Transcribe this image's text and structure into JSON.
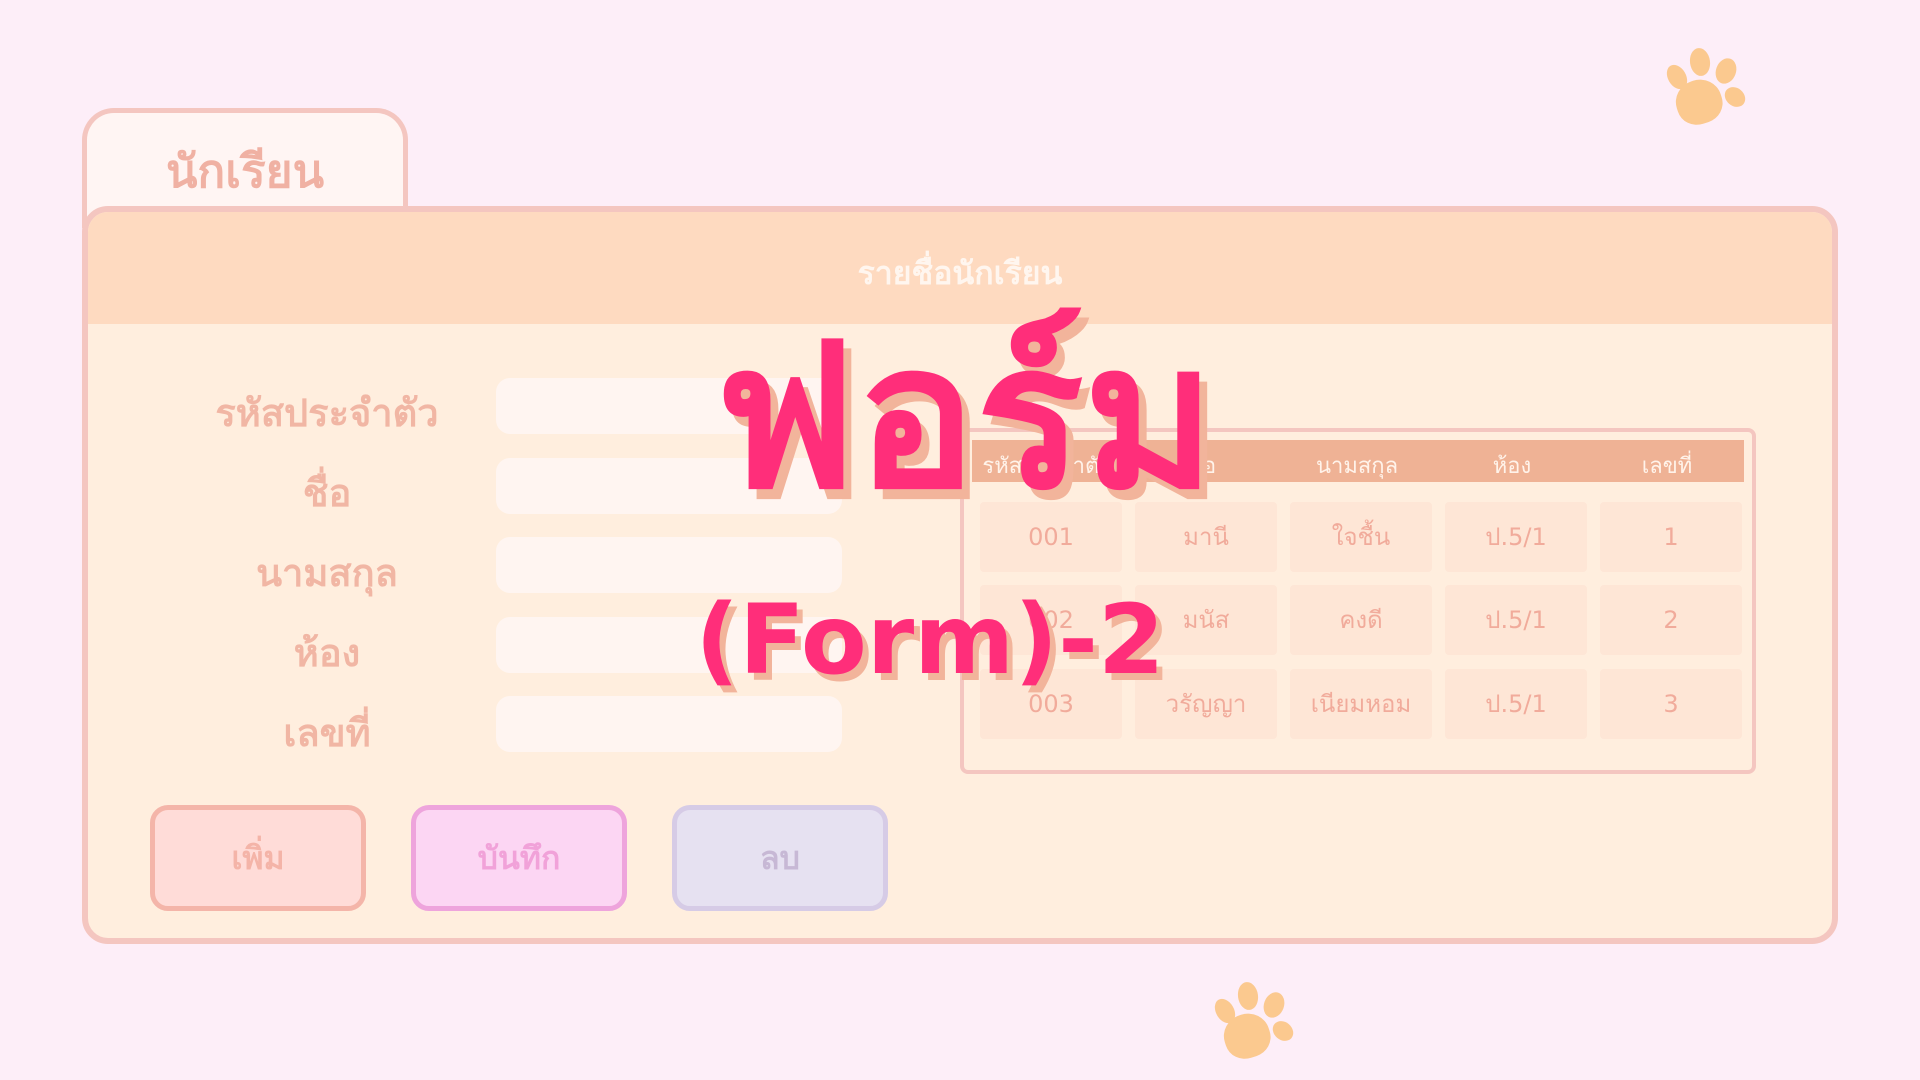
{
  "tab": {
    "label": "นักเรียน"
  },
  "window": {
    "title": "รายชื่อนักเรียน"
  },
  "form": {
    "fields": [
      {
        "label": "รหัสประจำตัว",
        "value": ""
      },
      {
        "label": "ชื่อ",
        "value": ""
      },
      {
        "label": "นามสกุล",
        "value": ""
      },
      {
        "label": "ห้อง",
        "value": ""
      },
      {
        "label": "เลขที่",
        "value": ""
      }
    ]
  },
  "table": {
    "headers": [
      "รหัสประจำตัว",
      "ชื่อ",
      "นามสกุล",
      "ห้อง",
      "เลขที่"
    ],
    "rows": [
      [
        "001",
        "มานี",
        "ใจชื้น",
        "ป.5/1",
        "1"
      ],
      [
        "002",
        "มนัส",
        "คงดี",
        "ป.5/1",
        "2"
      ],
      [
        "003",
        "วรัญญา",
        "เนียมหอม",
        "ป.5/1",
        "3"
      ]
    ]
  },
  "buttons": {
    "add": "เพิ่ม",
    "save": "บันทึก",
    "delete": "ลบ"
  },
  "overlay": {
    "title": "ฟอร์ม",
    "subtitle": "(Form)-2"
  },
  "colors": {
    "background": "#fdeef8",
    "accent": "#ff2e7a",
    "paw": "#fbc98f"
  },
  "icons": [
    "paw-icon"
  ]
}
